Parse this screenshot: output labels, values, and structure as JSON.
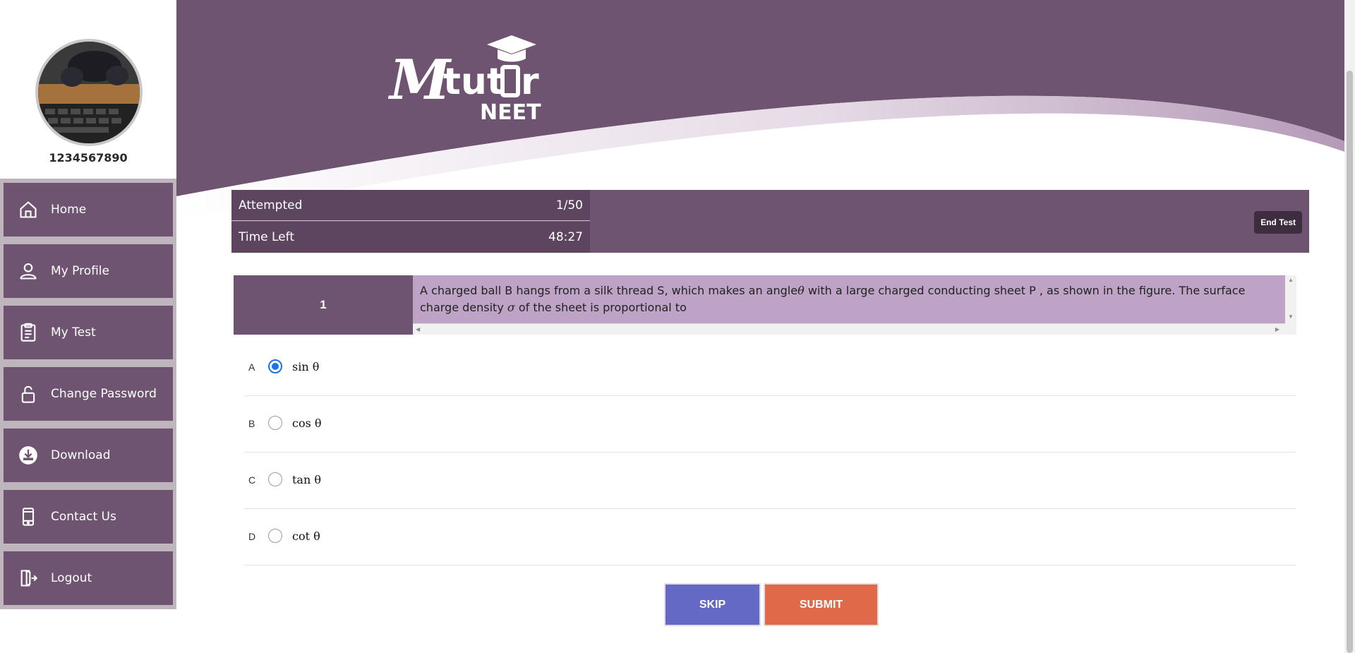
{
  "sidebar": {
    "user_id": "1234567890",
    "items": [
      {
        "label": "Home",
        "icon": "home-icon"
      },
      {
        "label": "My Profile",
        "icon": "user-icon"
      },
      {
        "label": "My Test",
        "icon": "clipboard-icon"
      },
      {
        "label": "Change Password",
        "icon": "lock-icon"
      },
      {
        "label": "Download",
        "icon": "download-icon"
      },
      {
        "label": "Contact Us",
        "icon": "phone-icon"
      },
      {
        "label": "Logout",
        "icon": "logout-icon"
      }
    ]
  },
  "header": {
    "logo_text": "Mtutor",
    "logo_sub": "NEET",
    "colors": {
      "primary": "#6e5470",
      "wave_light": "#bea3c6"
    }
  },
  "stats": {
    "attempted_label": "Attempted",
    "attempted_value": "1/50",
    "time_label": "Time Left",
    "time_value": "48:27",
    "end_test_label": "End Test"
  },
  "question": {
    "number": "1",
    "text_part1": "A charged ball B hangs from a silk thread S, which makes an angle",
    "theta": "θ",
    "text_part2": " with a large charged conducting sheet P , as shown in the figure. The surface charge density ",
    "sigma": "σ",
    "text_part3": " of the sheet is proportional to"
  },
  "options": [
    {
      "letter": "A",
      "text": "sin θ",
      "selected": true
    },
    {
      "letter": "B",
      "text": "cos θ",
      "selected": false
    },
    {
      "letter": "C",
      "text": "tan θ",
      "selected": false
    },
    {
      "letter": "D",
      "text": "cot θ",
      "selected": false
    }
  ],
  "actions": {
    "skip_label": "SKIP",
    "submit_label": "SUBMIT",
    "skip_color": "#6469c5",
    "submit_color": "#e0694a"
  }
}
